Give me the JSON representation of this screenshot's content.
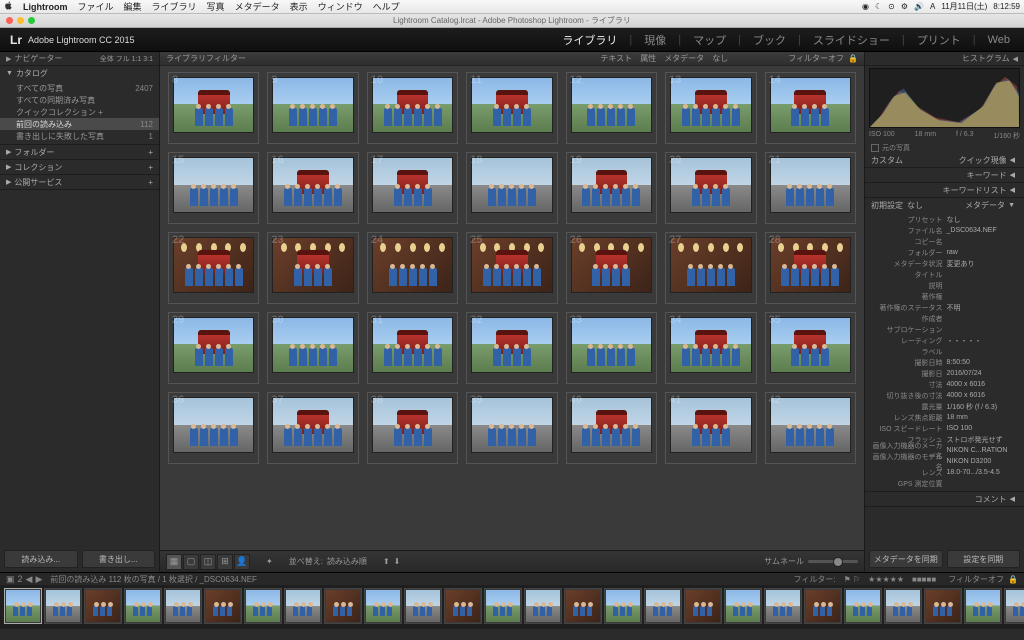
{
  "menubar": {
    "app": "Lightroom",
    "items": [
      "ファイル",
      "編集",
      "ライブラリ",
      "写真",
      "メタデータ",
      "表示",
      "ウィンドウ",
      "ヘルプ"
    ],
    "right": {
      "date": "11月11日(土)",
      "time": "8:12:59"
    }
  },
  "titlebar": "Lightroom Catalog.lrcat - Adobe Photoshop Lightroom - ライブラリ",
  "header": {
    "version": "Adobe Lightroom CC 2015",
    "modules": [
      "ライブラリ",
      "現像",
      "マップ",
      "ブック",
      "スライドショー",
      "プリント",
      "Web"
    ],
    "active": 0
  },
  "left": {
    "navigator": "ナビゲーター",
    "nav_opts": "全体  フル  1:1  3:1",
    "catalog": {
      "title": "カタログ",
      "items": [
        {
          "label": "すべての写真",
          "count": "2407"
        },
        {
          "label": "すべての同期済み写真",
          "count": ""
        },
        {
          "label": "クイックコレクション +",
          "count": ""
        },
        {
          "label": "前回の読み込み",
          "count": "112",
          "selected": true
        },
        {
          "label": "書き出しに失敗した写真",
          "count": "1"
        }
      ]
    },
    "folders": "フォルダー",
    "collections": "コレクション",
    "publish": "公開サービス",
    "btn_import": "読み込み...",
    "btn_export": "書き出し..."
  },
  "center": {
    "filter_label": "ライブラリフィルター",
    "filter_tabs": [
      "テキスト",
      "属性",
      "メタデータ",
      "なし"
    ],
    "filter_off": "フィルターオフ",
    "toolbar": {
      "sort_label": "並べ替え:",
      "sort_value": "読み込み順",
      "thumb_label": "サムネール"
    }
  },
  "right": {
    "histogram": "ヒストグラム",
    "histo_vals": {
      "iso": "ISO 100",
      "focal": "18 mm",
      "ap": "f / 6.3",
      "sh": "1/160 秒"
    },
    "lamp": "元の写真",
    "quick": {
      "custom": "カスタム",
      "title": "クイック現像"
    },
    "keywords": "キーワード",
    "keywordlist": "キーワードリスト",
    "metadata": {
      "title": "メタデータ",
      "preset_label": "初期設定",
      "preset_value": "なし",
      "rows": [
        {
          "l": "プリセット",
          "v": "なし"
        },
        {
          "l": "ファイル名",
          "v": "_DSC0634.NEF"
        },
        {
          "l": "コピー名",
          "v": ""
        },
        {
          "l": "フォルダー",
          "v": "raw"
        },
        {
          "l": "メタデータ状況",
          "v": "変更あり"
        },
        {
          "l": "タイトル",
          "v": ""
        },
        {
          "l": "説明",
          "v": ""
        },
        {
          "l": "著作権",
          "v": ""
        },
        {
          "l": "著作権のステータス",
          "v": "不明"
        },
        {
          "l": "作成者",
          "v": ""
        },
        {
          "l": "サブロケーション",
          "v": ""
        },
        {
          "l": "レーティング",
          "v": "・・・・・"
        },
        {
          "l": "ラベル",
          "v": ""
        },
        {
          "l": "撮影日時",
          "v": "8:50:50"
        },
        {
          "l": "撮影日",
          "v": "2016/07/24"
        },
        {
          "l": "寸法",
          "v": "4000 x 6016"
        },
        {
          "l": "切り抜き後の寸法",
          "v": "4000 x 6016"
        },
        {
          "l": "露光量",
          "v": "1/160 秒 (f / 6.3)"
        },
        {
          "l": "レンズ焦点距離",
          "v": "18 mm"
        },
        {
          "l": "ISO スピードレート",
          "v": "ISO 100"
        },
        {
          "l": "フラッシュ",
          "v": "ストロボ発光せず"
        },
        {
          "l": "画像入力機器のメーカー名",
          "v": "NIKON C...RATION"
        },
        {
          "l": "画像入力機器のモデル名",
          "v": "NIKON D3200"
        },
        {
          "l": "レンズ",
          "v": "18.0-70.../3.5-4.5"
        },
        {
          "l": "GPS 測定位置",
          "v": ""
        }
      ]
    },
    "comments": "コメント",
    "btn_meta": "メタデータを同期",
    "btn_sync": "設定を同期"
  },
  "filmstrip": {
    "info": "前回の読み込み  112 枚の写真 / 1 枚選択 / _DSC0634.NEF",
    "filter_label": "フィルター:",
    "filter_off": "フィルターオフ"
  },
  "thumbs": {
    "start": 8,
    "total": 35,
    "cut_row": 5
  }
}
